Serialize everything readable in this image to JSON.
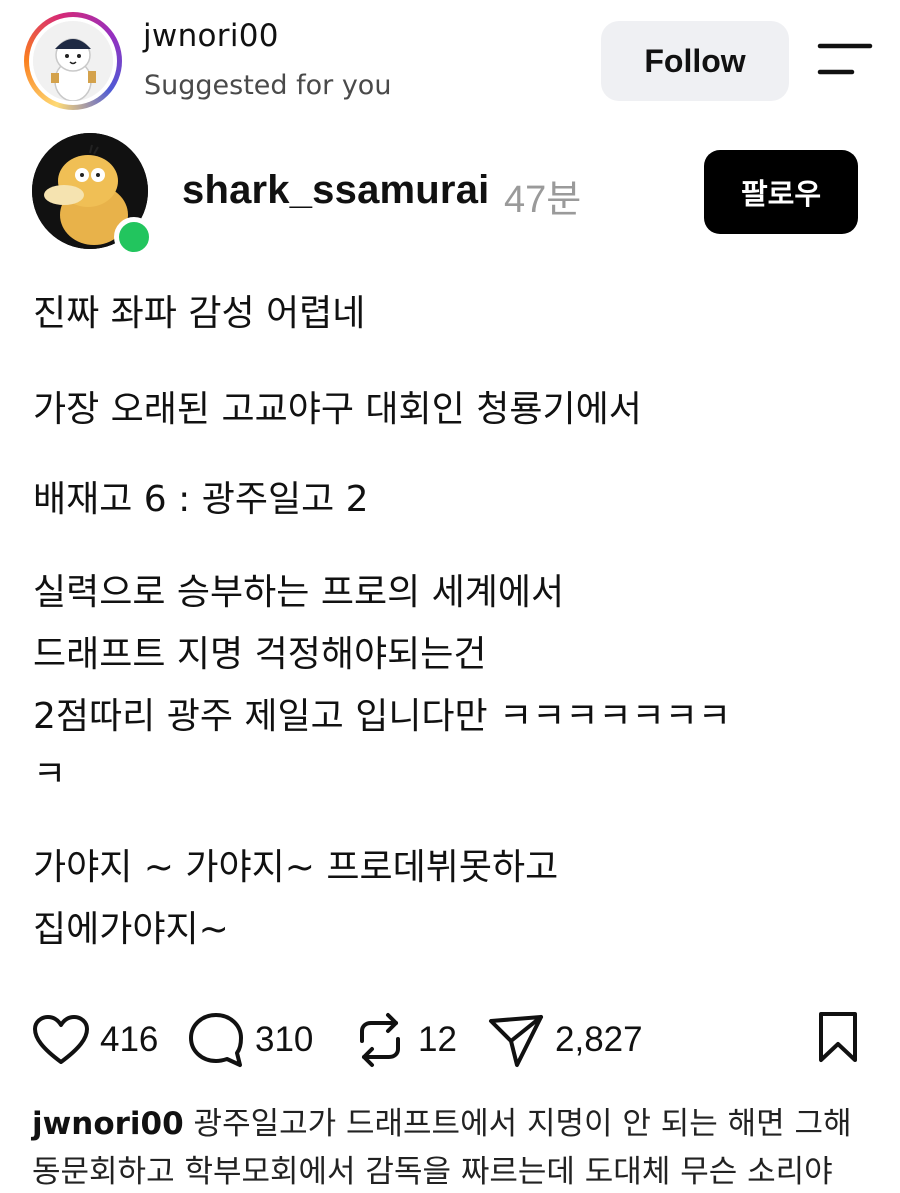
{
  "suggested": {
    "username": "jwnori00",
    "subtitle": "Suggested for you",
    "follow_label": "Follow"
  },
  "post": {
    "username": "shark_ssamurai",
    "time": "47분",
    "follow_label": "팔로우",
    "lines": [
      "진짜 좌파 감성 어렵네",
      "가장 오래된 고교야구 대회인 청룡기에서",
      "배재고 6 : 광주일고 2",
      "실력으로 승부하는 프로의 세계에서",
      "드래프트 지명 걱정해야되는건",
      "2점따리 광주 제일고 입니다만 ㅋㅋㅋㅋㅋㅋㅋ",
      "ㅋ",
      "가야지 ~ 가야지~ 프로데뷔못하고",
      "집에가야지~"
    ],
    "likes": "416",
    "comments": "310",
    "reposts": "12",
    "shares": "2,827"
  },
  "comment_preview": {
    "username": "jwnori00",
    "line1": "광주일고가 드래프트에서 지명이 안 되는 해면 그해",
    "line2": "동문회하고 학부모회에서 감독을 짜르는데 도대체 무슨 소리야"
  },
  "icons": {
    "menu": "menu-icon",
    "like": "heart-icon",
    "comment": "comment-bubble-icon",
    "repost": "repost-icon",
    "share": "send-icon",
    "bookmark": "bookmark-icon"
  },
  "colors": {
    "online": "#22c55e",
    "follow_bg": "#eff0f3",
    "follow_kr_bg": "#000000",
    "muted": "#9a9a9a"
  }
}
